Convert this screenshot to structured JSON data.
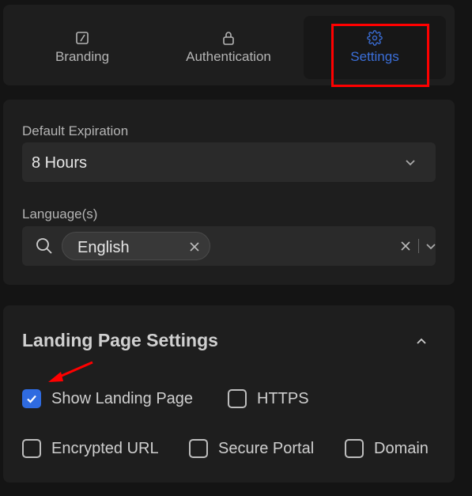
{
  "tabs": [
    {
      "label": "Branding",
      "icon": "branding-icon",
      "active": false
    },
    {
      "label": "Authentication",
      "icon": "lock-icon",
      "active": false
    },
    {
      "label": "Settings",
      "icon": "gear-icon",
      "active": true
    }
  ],
  "default_expiration": {
    "label": "Default Expiration",
    "value": "8 Hours"
  },
  "languages": {
    "label": "Language(s)",
    "selected": [
      "English"
    ]
  },
  "landing": {
    "title": "Landing Page Settings",
    "options": [
      {
        "label": "Show Landing Page",
        "checked": true
      },
      {
        "label": "HTTPS",
        "checked": false
      },
      {
        "label": "Encrypted URL",
        "checked": false
      },
      {
        "label": "Secure Portal",
        "checked": false
      },
      {
        "label": "Domain",
        "checked": false
      }
    ]
  },
  "colors": {
    "accent": "#2f6be0",
    "annotation": "#ff0000"
  }
}
